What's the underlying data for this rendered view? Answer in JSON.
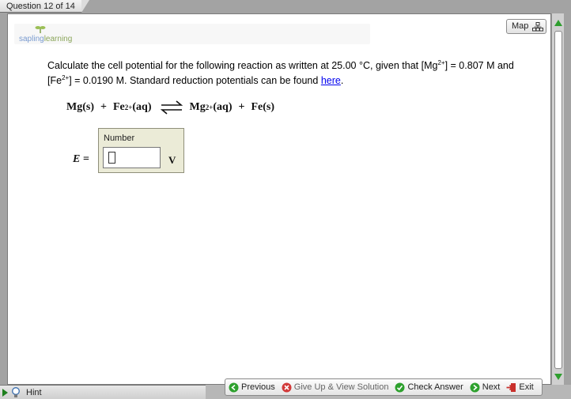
{
  "header": {
    "question_tab": "Question 12 of 14"
  },
  "logo": {
    "part1": "sapling",
    "part2": "learning"
  },
  "map_button": {
    "label": "Map"
  },
  "question": {
    "text_before": "Calculate the cell potential for the following reaction as written at 25.00 °C, given that [Mg",
    "sup1": "2+",
    "text_mid1": "] = 0.807 M and [Fe",
    "sup2": "2+",
    "text_mid2": "] = 0.0190 M. Standard reduction potentials can be found ",
    "link": "here",
    "text_end": "."
  },
  "equation": {
    "reactant1": "Mg(s)",
    "plus1": "+",
    "reactant2": "Fe",
    "reactant2_sup": "2+",
    "reactant2_state": "(aq)",
    "product1": "Mg",
    "product1_sup": "2+",
    "product1_state": "(aq)",
    "plus2": "+",
    "product2": "Fe(s)"
  },
  "answer": {
    "variable_label": "E =",
    "box_label": "Number",
    "value": "",
    "unit": "V"
  },
  "footer": {
    "hint": "Hint",
    "previous": "Previous",
    "give_up": "Give Up & View Solution",
    "check": "Check Answer",
    "next": "Next",
    "exit": "Exit"
  },
  "colors": {
    "link": "#0000ee",
    "green_icon": "#2ea12e",
    "red_icon": "#d23a3a",
    "number_box_bg": "#ebebd7"
  }
}
